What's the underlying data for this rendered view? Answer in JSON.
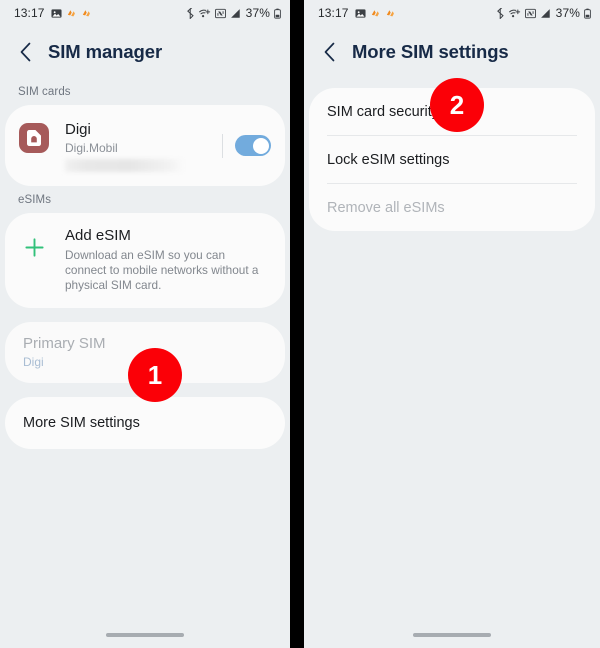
{
  "status_bar": {
    "time": "13:17",
    "battery_text": "37%",
    "left_icons": [
      "photo-icon",
      "app-notification-icon",
      "app-notification-icon"
    ],
    "right_icons": [
      "bluetooth-icon",
      "wifi-calling-icon",
      "nfc-icon",
      "signal-icon",
      "battery-icon"
    ],
    "accent_orange": "#f08a1e"
  },
  "left_panel": {
    "header": {
      "back_icon": "back-chevron-icon",
      "title": "SIM manager"
    },
    "sim_cards_label": "SIM cards",
    "sim_card": {
      "icon": "sim-card-icon",
      "icon_color": "#a65a5a",
      "name": "Digi",
      "subtitle": "Digi.Mobil",
      "redacted_note": "",
      "toggle_on": true,
      "toggle_color": "#72abdd"
    },
    "esims_label": "eSIMs",
    "add_esim": {
      "icon": "plus-icon",
      "icon_color": "#31c17a",
      "title": "Add eSIM",
      "description": "Download an eSIM so you can connect to mobile networks without a physical SIM card."
    },
    "primary_sim": {
      "title": "Primary SIM",
      "value": "Digi",
      "disabled": true
    },
    "more_sim_settings": {
      "label": "More SIM settings"
    },
    "badge": "1"
  },
  "right_panel": {
    "header": {
      "back_icon": "back-chevron-icon",
      "title": "More SIM settings"
    },
    "items": [
      {
        "label": "SIM card security",
        "disabled": false
      },
      {
        "label": "Lock eSIM settings",
        "disabled": false
      },
      {
        "label": "Remove all eSIMs",
        "disabled": true
      }
    ],
    "badge": "2"
  },
  "colors": {
    "background": "#eceff1",
    "card": "#fbfbfb",
    "title": "#172a47",
    "badge_red": "#fb0007",
    "divider": "#e6e8ea"
  }
}
